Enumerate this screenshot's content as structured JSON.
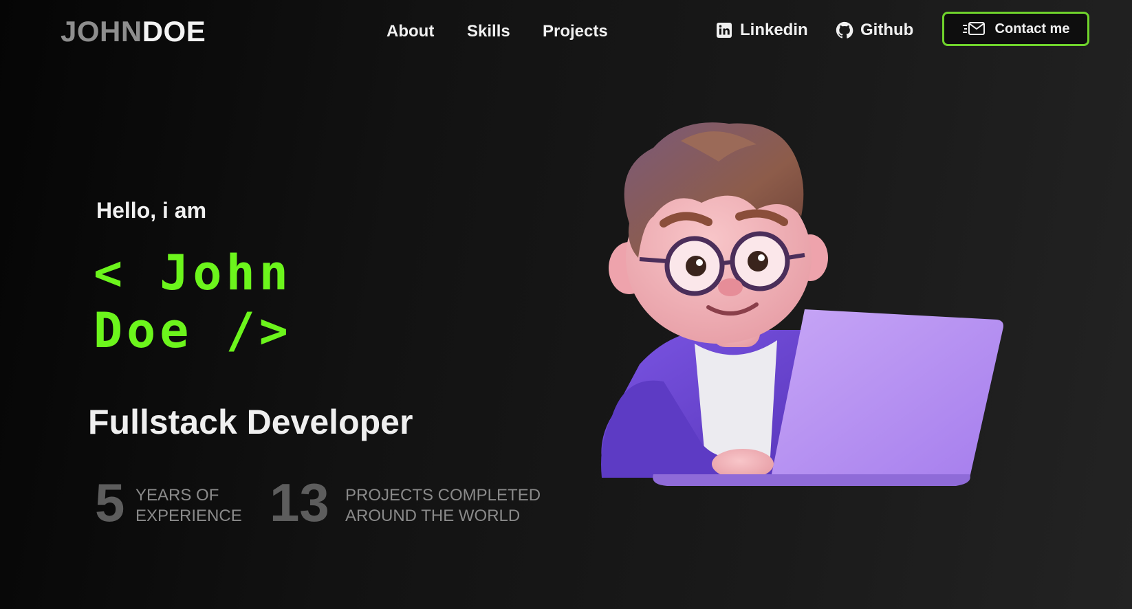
{
  "header": {
    "logo_first": "JOHN",
    "logo_last": "DOE",
    "nav": [
      {
        "label": "About"
      },
      {
        "label": "Skills"
      },
      {
        "label": "Projects"
      }
    ],
    "socials": [
      {
        "label": "Linkedin",
        "icon": "linkedin-icon"
      },
      {
        "label": "Github",
        "icon": "github-icon"
      }
    ],
    "contact_label": "Contact me",
    "contact_icon": "envelope-icon"
  },
  "hero": {
    "greeting": "Hello, i am",
    "name_line1": "< John",
    "name_line2": "Doe />",
    "role": "Fullstack Developer",
    "stats": [
      {
        "number": "5",
        "line1": "YEARS OF",
        "line2": "EXPERIENCE"
      },
      {
        "number": "13",
        "line1": "PROJECTS COMPLETED",
        "line2": "AROUND THE WORLD"
      }
    ]
  },
  "colors": {
    "accent": "#6cf51c",
    "button_border": "#6fd32c",
    "background": "#121212",
    "muted_number": "#5d5d5d",
    "avatar_jacket": "#6a45d6",
    "avatar_laptop": "#b58cf2"
  }
}
